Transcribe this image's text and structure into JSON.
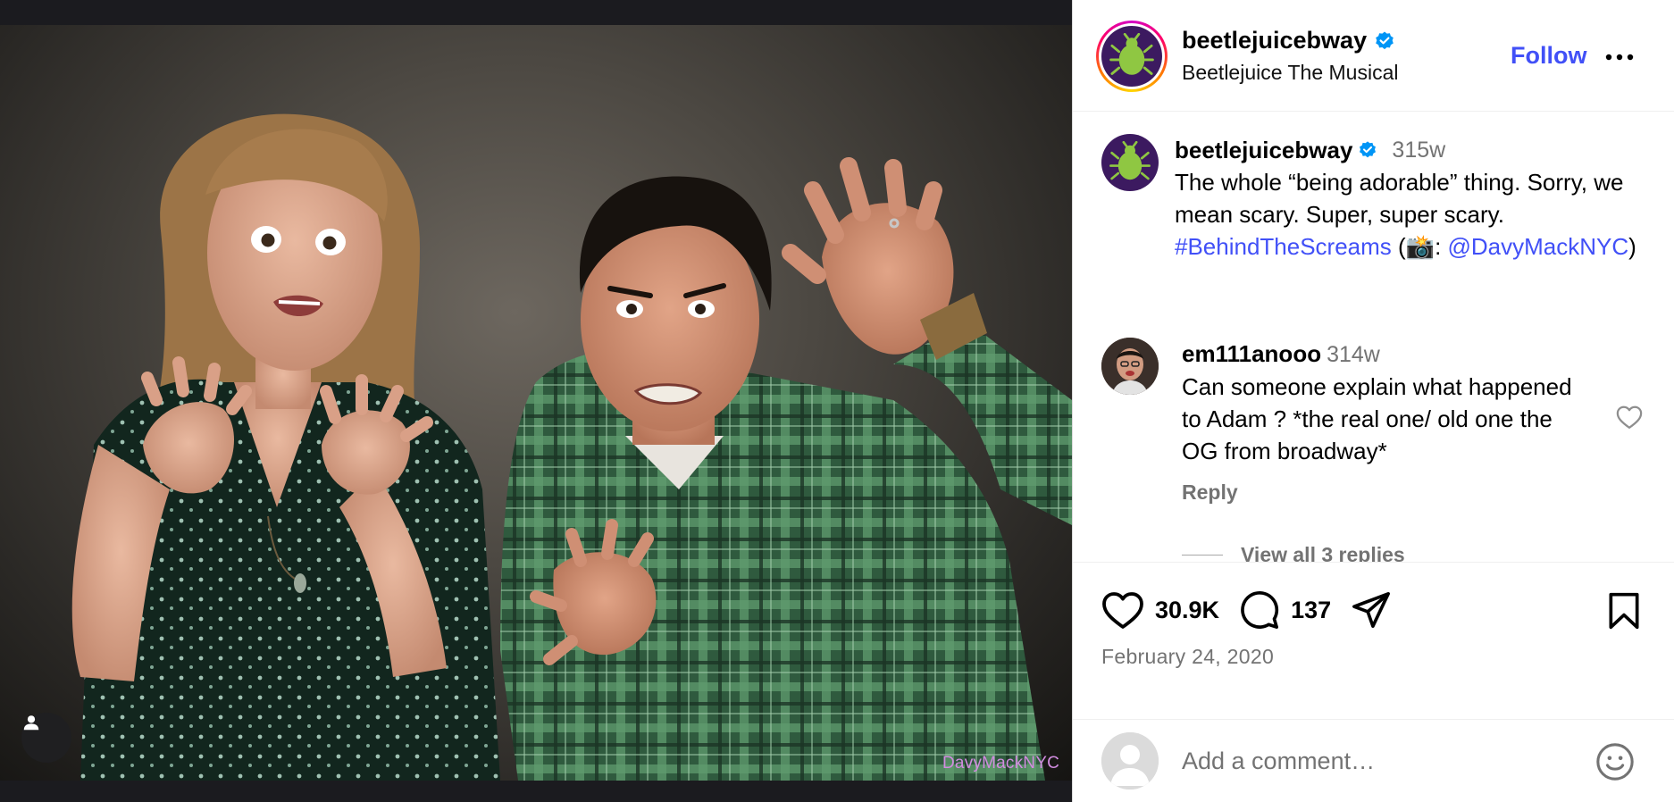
{
  "media": {
    "watermark": "DavyMackNYC"
  },
  "header": {
    "username": "beetlejuicebway",
    "subtitle": "Beetlejuice The Musical",
    "follow_label": "Follow"
  },
  "caption": {
    "username": "beetlejuicebway",
    "time": "315w",
    "text": "The whole “being adorable” thing. Sorry, we mean scary. Super, super scary. ",
    "hashtag": "#BehindTheScreams",
    "camera_prefix": " (📸: ",
    "mention": "@DavyMackNYC",
    "close": ")"
  },
  "comment": {
    "username": "em111anooo",
    "time": "314w",
    "text": "Can someone explain what happened to Adam ? *the real one/ old one the OG from broadway*",
    "reply_label": "Reply",
    "view_replies": "View all 3 replies"
  },
  "actions": {
    "likes": "30.9K",
    "comments": "137"
  },
  "date": "February 24, 2020",
  "add_comment": {
    "placeholder": "Add a comment…"
  },
  "colors": {
    "accent": "#4150f7",
    "verified": "#0095f6",
    "muted": "#737373",
    "brand_purple": "#3c1a60",
    "bug_green": "#8fc742",
    "watermark": "#d28ce0"
  },
  "icons": [
    "tag-people-icon",
    "verified-icon",
    "more-icon",
    "heart-icon",
    "comment-icon",
    "share-icon",
    "bookmark-icon",
    "emoji-icon",
    "beetle-icon"
  ]
}
